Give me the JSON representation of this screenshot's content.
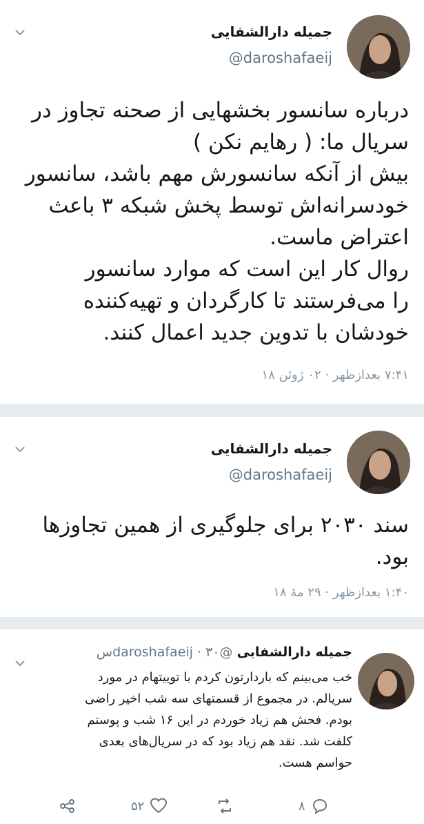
{
  "tweets": [
    {
      "name": "جمیله دارالشفایی",
      "handle": "@daroshafaeij",
      "body": "درباره سانسور بخشهایی از صحنه تجاوز در\nسریال ما: ( رهایم نکن )\nبیش از آنکه سانسورش مهم باشد، سانسور\nخودسرانه‌اش توسط پخش شبکه ۳ باعث\nاعتراض ماست.\nروال کار این است که موارد سانسور\nرا می‌فرستند تا کارگردان و تهیه‌کننده\nخودشان با تدوین جدید اعمال کنند.",
      "timestamp": "۷:۴۱ بعدازظهر · ۰۲ ژوئن ۱۸"
    },
    {
      "name": "جمیله دارالشفایی",
      "handle": "@daroshafaeij",
      "body": "سند ۲۰۳۰ برای جلوگیری از همین تجاوزها\nبود.",
      "timestamp": "۱:۴۰ بعدازظهر · ۲۹ مهٔ ۱۸"
    },
    {
      "name": "جمیله دارالشفایی",
      "handle": "@daroshafaeij",
      "time": "۳۰س",
      "body": "خب می‌بینم که باردارتون کردم با توییتهام در مورد\nسریالم. در مجموع از قسمتهای سه شب اخیر راضی\nبودم. فحش هم زیاد خوردم در این ۱۶ شب و پوستم\nکلفت شد. نقد هم زیاد بود که در سریال‌های بعدی\nحواسم هست.",
      "reply_count": "۸",
      "like_count": "۵۲"
    }
  ],
  "icons": [
    "chevron-down-icon",
    "reply-icon",
    "retweet-icon",
    "like-icon",
    "share-icon"
  ],
  "colors": {
    "secondary_text": "#657786",
    "timestamp": "#8899a6",
    "separator": "#e6ecf0"
  }
}
